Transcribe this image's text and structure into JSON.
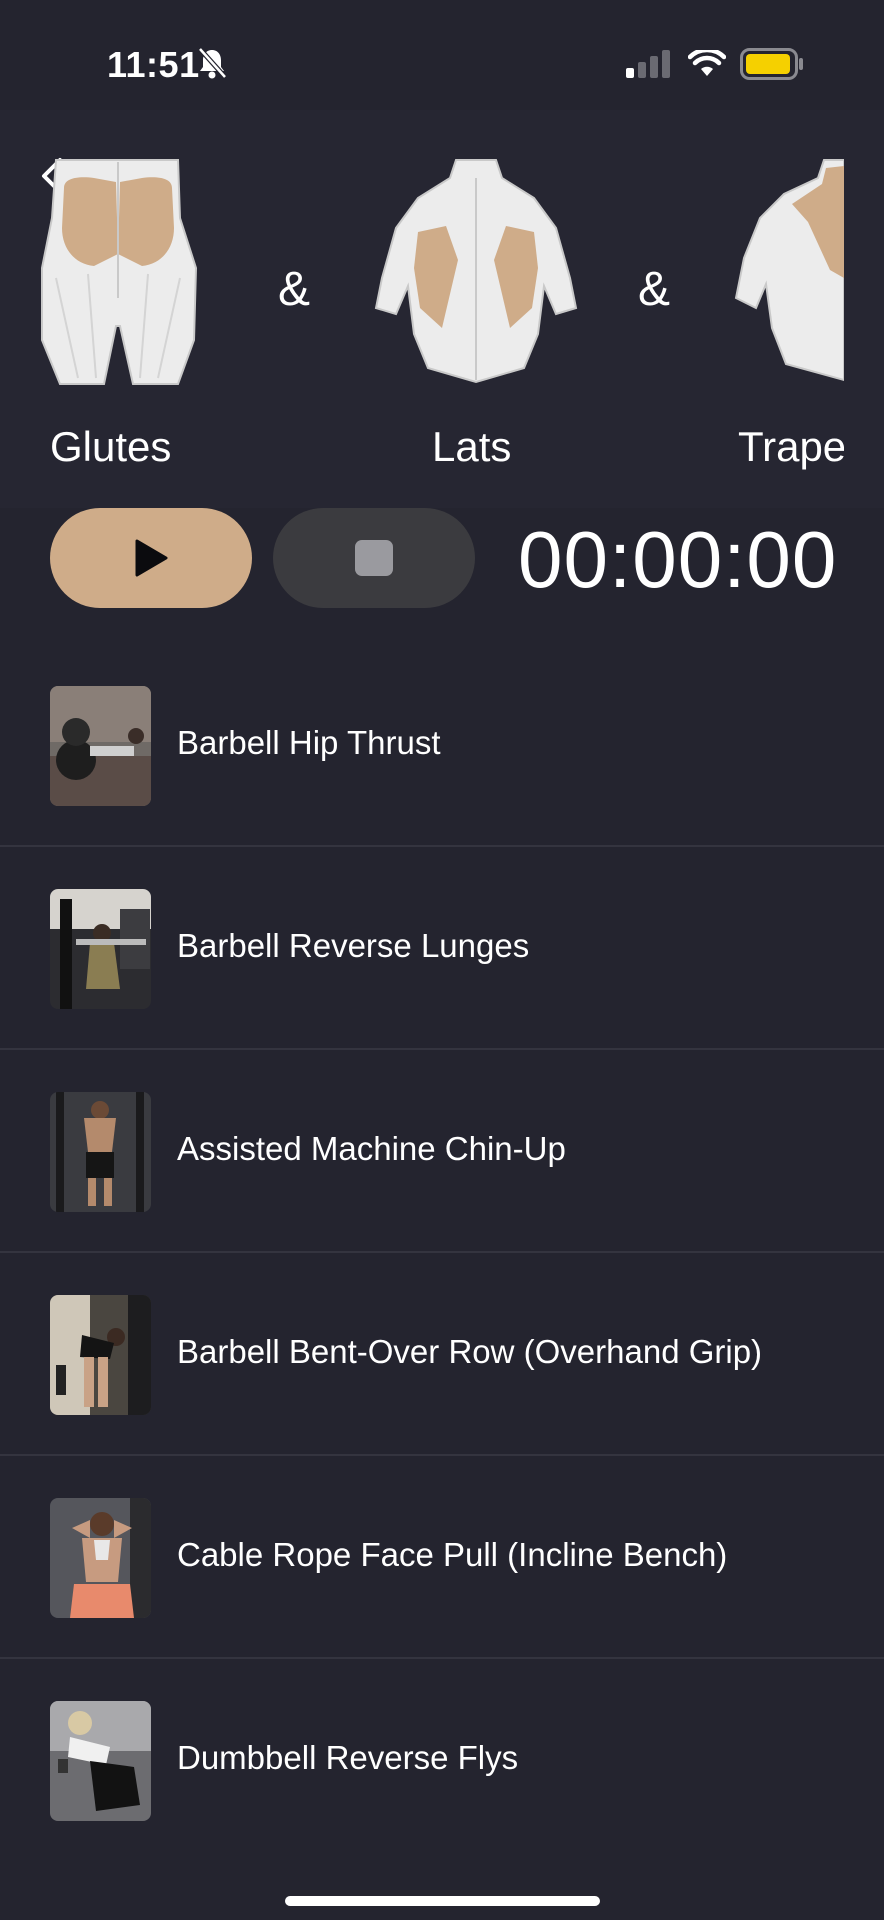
{
  "status_bar": {
    "time": "11:51",
    "icons": [
      "bell-slash-icon",
      "signal-icon",
      "wifi-icon",
      "battery-icon"
    ],
    "battery_color": "#f5d000"
  },
  "header": {
    "back_icon": "chevron-left-icon",
    "muscles": [
      {
        "label": "Glutes",
        "icon": "glutes-figure-icon"
      },
      {
        "label": "Lats",
        "icon": "back-figure-icon"
      },
      {
        "label": "Trape",
        "icon": "trapezius-figure-icon"
      }
    ],
    "separator": "&"
  },
  "controls": {
    "play_icon": "play-icon",
    "stop_icon": "stop-icon",
    "timer": "00:00:00",
    "accent_color": "#cfac89"
  },
  "exercises": [
    {
      "name": "Barbell Hip Thrust"
    },
    {
      "name": "Barbell Reverse Lunges"
    },
    {
      "name": "Assisted Machine Chin-Up"
    },
    {
      "name": "Barbell Bent-Over Row (Overhand Grip)"
    },
    {
      "name": "Cable Rope Face Pull (Incline Bench)"
    },
    {
      "name": "Dumbbell Reverse Flys"
    }
  ]
}
